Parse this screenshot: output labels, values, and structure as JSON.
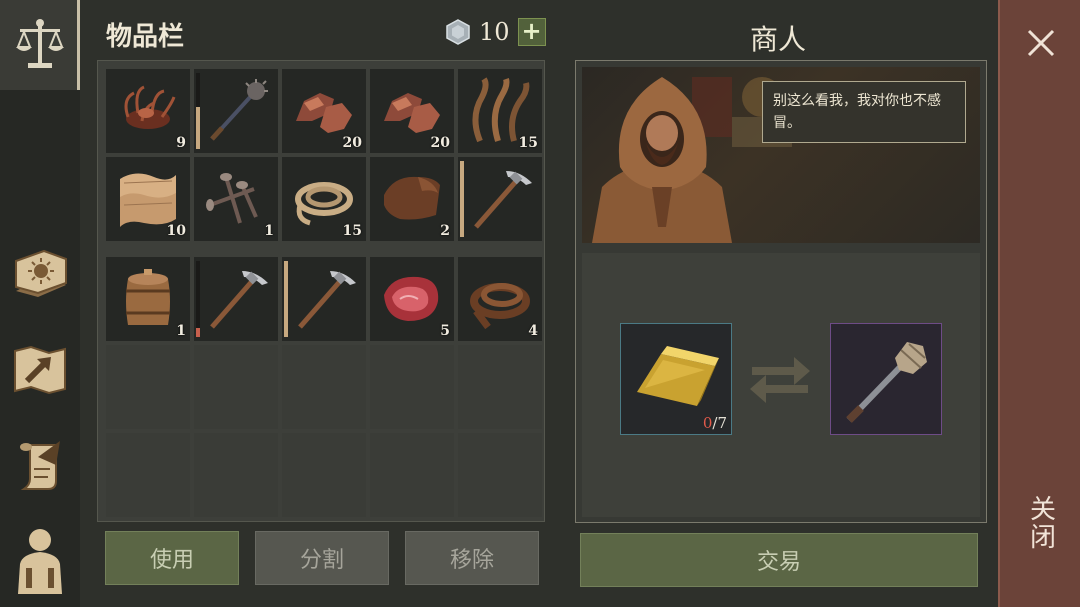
{
  "inventory": {
    "title": "物品栏",
    "currency": {
      "icon": "silver-coin-icon",
      "amount": "10",
      "add_label": "+"
    },
    "rows": [
      [
        {
          "icon": "tendril-organ-icon",
          "count": "9"
        },
        {
          "icon": "spiked-mace-icon",
          "count": "",
          "durability": 0.55,
          "durability_color": "#c7a980"
        },
        {
          "icon": "copper-ore-icon",
          "count": "20"
        },
        {
          "icon": "copper-ore-icon",
          "count": "20"
        },
        {
          "icon": "dried-kelp-icon",
          "count": "15"
        }
      ],
      [
        {
          "icon": "tanned-leather-icon",
          "count": "10"
        },
        {
          "icon": "nails-icon",
          "count": "1"
        },
        {
          "icon": "rope-icon",
          "count": "15"
        },
        {
          "icon": "leather-hide-icon",
          "count": "2"
        },
        {
          "icon": "pickaxe-icon",
          "count": "",
          "durability": 1.0,
          "durability_color": "#c7a980"
        }
      ],
      [
        {
          "icon": "barrel-icon",
          "count": "1"
        },
        {
          "icon": "pickaxe-icon",
          "count": "",
          "durability": 0.12,
          "durability_color": "#c7604d"
        },
        {
          "icon": "pickaxe-icon",
          "count": "",
          "durability": 1.0,
          "durability_color": "#c7a980"
        },
        {
          "icon": "raw-meat-icon",
          "count": "5"
        },
        {
          "icon": "leather-strip-icon",
          "count": "4"
        }
      ]
    ],
    "buttons": {
      "use": "使用",
      "split": "分割",
      "remove": "移除"
    }
  },
  "merchant": {
    "title": "商人",
    "speech": "别这么看我，我对你也不感冒。",
    "offer": {
      "icon": "gold-bar-icon",
      "have": "0",
      "need": "/7"
    },
    "reward": {
      "icon": "mace-icon"
    },
    "trade_label": "交易"
  },
  "nav": {
    "tabs": [
      "scales-icon",
      "daylight-book-icon",
      "map-arrow-icon",
      "quest-scroll-icon",
      "character-icon"
    ]
  },
  "close": {
    "label": "关闭"
  }
}
